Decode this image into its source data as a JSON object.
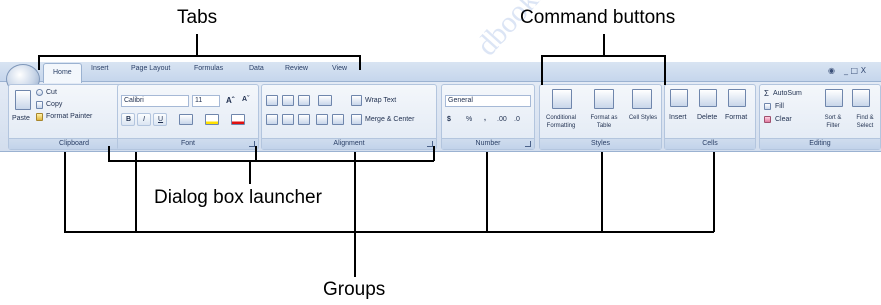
{
  "callouts": {
    "tabs": "Tabs",
    "command_buttons": "Command buttons",
    "dialog_launcher": "Dialog box launcher",
    "groups": "Groups"
  },
  "ribbon": {
    "tabs": [
      "Home",
      "Insert",
      "Page Layout",
      "Formulas",
      "Data",
      "Review",
      "View"
    ],
    "window_controls": "_ □ X",
    "groups": {
      "clipboard": {
        "label": "Clipboard",
        "paste": "Paste",
        "cut": "Cut",
        "copy": "Copy",
        "format_painter": "Format Painter"
      },
      "font": {
        "label": "Font",
        "font_name": "Calibri",
        "font_size": "11",
        "grow": "Aˆ",
        "shrink": "Aˇ",
        "bold": "B",
        "italic": "I",
        "underline": "U"
      },
      "alignment": {
        "label": "Alignment",
        "wrap_text": "Wrap Text",
        "merge_center": "Merge & Center"
      },
      "number": {
        "label": "Number",
        "format": "General",
        "currency": "$",
        "percent": "%",
        "comma": ",",
        "inc_decimal": ".00",
        "dec_decimal": ".0"
      },
      "styles": {
        "label": "Styles",
        "conditional_formatting": "Conditional Formatting",
        "format_as_table": "Format as Table",
        "cell_styles": "Cell Styles"
      },
      "cells": {
        "label": "Cells",
        "insert": "Insert",
        "delete": "Delete",
        "format": "Format"
      },
      "editing": {
        "label": "Editing",
        "autosum": "AutoSum",
        "fill": "Fill",
        "clear": "Clear",
        "sort_filter": "Sort & Filter",
        "find_select": "Find & Select"
      }
    }
  },
  "watermark": "dbookshop.com"
}
